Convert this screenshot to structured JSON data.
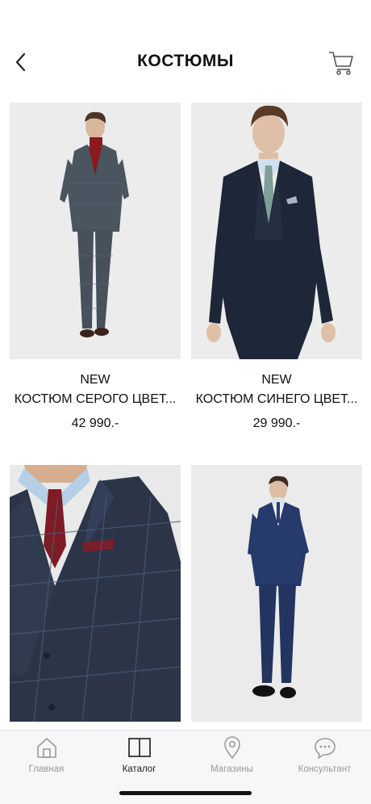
{
  "header": {
    "title": "КОСТЮМЫ",
    "back_icon": "chevron-left-icon",
    "cart_icon": "cart-icon"
  },
  "products": [
    {
      "badge": "NEW",
      "name": "КОСТЮМ СЕРОГО ЦВЕТ...",
      "price": "42 990.-"
    },
    {
      "badge": "NEW",
      "name": "КОСТЮМ СИНЕГО ЦВЕТ...",
      "price": "29 990.-"
    },
    {
      "badge": "",
      "name": "",
      "price": ""
    },
    {
      "badge": "",
      "name": "",
      "price": ""
    }
  ],
  "tabbar": {
    "items": [
      {
        "label": "Главная",
        "icon": "home-icon",
        "active": false
      },
      {
        "label": "Каталог",
        "icon": "book-icon",
        "active": true
      },
      {
        "label": "Магазины",
        "icon": "map-pin-icon",
        "active": false
      },
      {
        "label": "Консультант",
        "icon": "chat-bubble-icon",
        "active": false
      }
    ]
  },
  "colors": {
    "text": "#111111",
    "tab_inactive": "#999999",
    "tab_active": "#222222",
    "photo_bg": "#ececec"
  }
}
